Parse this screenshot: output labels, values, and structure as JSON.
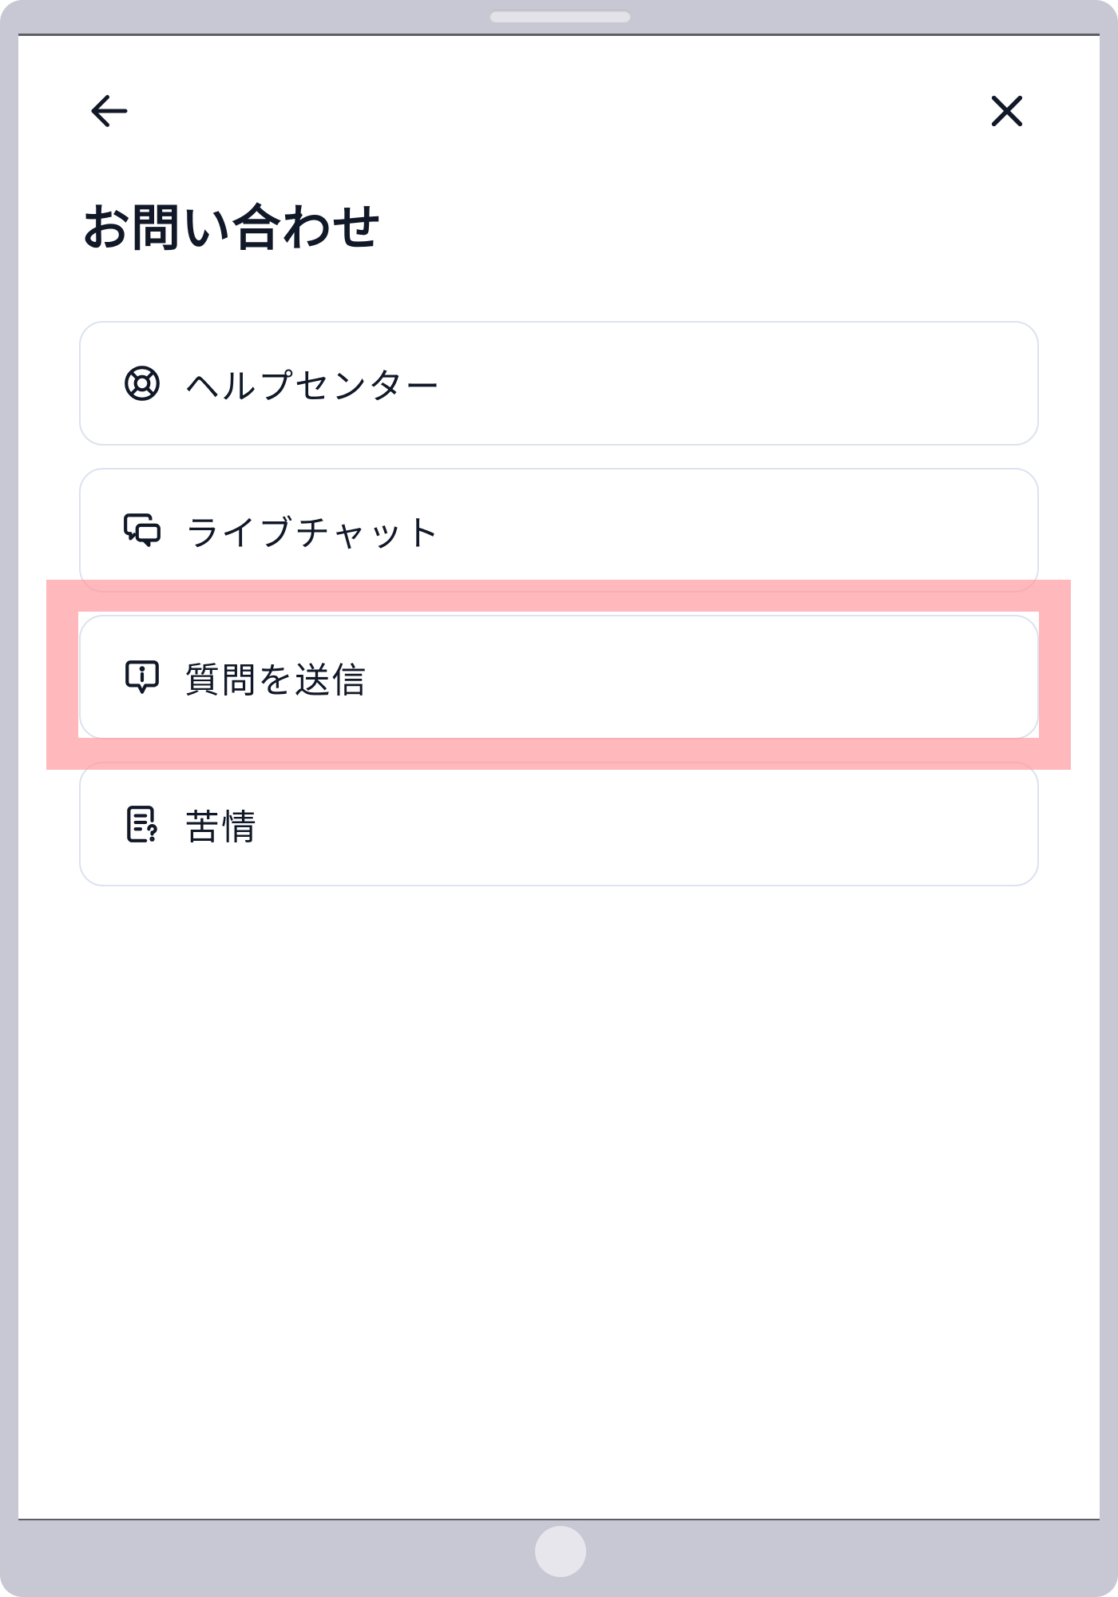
{
  "header": {
    "back_icon": "arrow-left-icon",
    "close_icon": "close-icon",
    "title": "お問い合わせ"
  },
  "menu": {
    "items": [
      {
        "label": "ヘルプセンター",
        "icon": "lifebuoy-icon"
      },
      {
        "label": "ライブチャット",
        "icon": "chat-bubbles-icon"
      },
      {
        "label": "質問を送信",
        "icon": "message-info-icon"
      },
      {
        "label": "苦情",
        "icon": "complaint-document-icon"
      }
    ]
  },
  "highlight": {
    "target": "質問を送信",
    "color": "#ff9a9e"
  },
  "colors": {
    "text": "#111827",
    "card_border": "#dce3ef",
    "device_frame": "#c8c8d4"
  }
}
